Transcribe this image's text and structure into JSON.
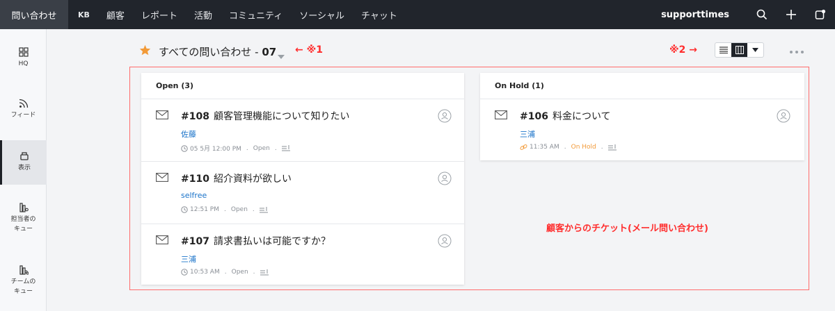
{
  "topbar": {
    "active_tab": "問い合わせ",
    "tabs": [
      "KB",
      "顧客",
      "レポート",
      "活動",
      "コミュニティ",
      "ソーシャル",
      "チャット"
    ],
    "brand": "supporttimes"
  },
  "sidebar": {
    "items": [
      {
        "label": "HQ",
        "icon": "grid-icon"
      },
      {
        "label": "フィード",
        "icon": "feed-icon"
      },
      {
        "label": "表示",
        "icon": "view-icon",
        "active": true
      },
      {
        "label": "担当者の\nキュー",
        "icon": "agent-queue-icon"
      },
      {
        "label": "チームの\nキュー",
        "icon": "team-queue-icon"
      }
    ]
  },
  "header": {
    "view_name": "すべての問い合わせ - ",
    "view_suffix": "07",
    "annotation_1": "← ※1",
    "annotation_2": "※2 →"
  },
  "columns": [
    {
      "title": "Open (3)",
      "tickets": [
        {
          "number": "#108",
          "subject": "顧客管理機能について知りたい",
          "contact": "佐藤",
          "time": "05 5月 12:00 PM",
          "status": "Open"
        },
        {
          "number": "#110",
          "subject": "紹介資料が欲しい",
          "contact": "selfree",
          "time": "12:51 PM",
          "status": "Open"
        },
        {
          "number": "#107",
          "subject": "請求書払いは可能ですか？",
          "contact": "三浦",
          "time": "10:53 AM",
          "status": "Open"
        }
      ]
    },
    {
      "title": "On Hold (1)",
      "tickets": [
        {
          "number": "#106",
          "subject": "料金について",
          "contact": "三浦",
          "time": "11:35 AM",
          "status": "On Hold"
        }
      ]
    }
  ],
  "note": "顧客からのチケット(メール問い合わせ)",
  "colors": {
    "accent_red": "#ff2d2d",
    "link_blue": "#1a73c9",
    "onhold_orange": "#f29a38",
    "topbar": "#21252c"
  }
}
